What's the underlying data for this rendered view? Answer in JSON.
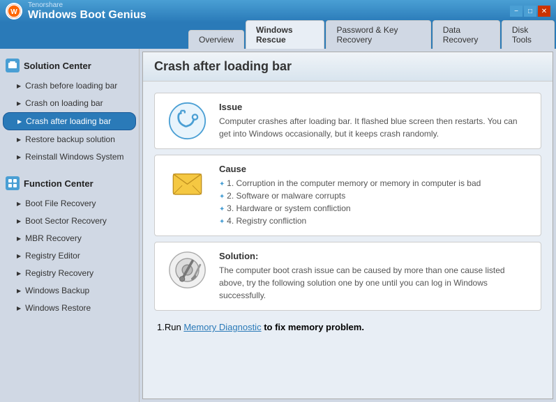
{
  "titlebar": {
    "company": "Tenorshare",
    "app_name": "Windows Boot Genius",
    "min_label": "−",
    "max_label": "□",
    "close_label": "✕"
  },
  "navbar": {
    "tabs": [
      {
        "id": "overview",
        "label": "Overview",
        "active": false
      },
      {
        "id": "windows-rescue",
        "label": "Windows Rescue",
        "active": true
      },
      {
        "id": "password-recovery",
        "label": "Password & Key Recovery",
        "active": false
      },
      {
        "id": "data-recovery",
        "label": "Data Recovery",
        "active": false
      },
      {
        "id": "disk-tools",
        "label": "Disk Tools",
        "active": false
      }
    ]
  },
  "sidebar": {
    "solution_center": {
      "header": "Solution Center",
      "items": [
        {
          "id": "crash-before",
          "label": "Crash before loading bar",
          "active": false
        },
        {
          "id": "crash-on",
          "label": "Crash on loading bar",
          "active": false
        },
        {
          "id": "crash-after",
          "label": "Crash after loading bar",
          "active": true
        },
        {
          "id": "restore-backup",
          "label": "Restore backup solution",
          "active": false
        },
        {
          "id": "reinstall-windows",
          "label": "Reinstall Windows System",
          "active": false
        }
      ]
    },
    "function_center": {
      "header": "Function Center",
      "items": [
        {
          "id": "boot-file",
          "label": "Boot File Recovery",
          "active": false
        },
        {
          "id": "boot-sector",
          "label": "Boot Sector Recovery",
          "active": false
        },
        {
          "id": "mbr-recovery",
          "label": "MBR Recovery",
          "active": false
        },
        {
          "id": "registry-editor",
          "label": "Registry Editor",
          "active": false
        },
        {
          "id": "registry-recovery",
          "label": "Registry Recovery",
          "active": false
        },
        {
          "id": "windows-backup",
          "label": "Windows Backup",
          "active": false
        },
        {
          "id": "windows-restore",
          "label": "Windows Restore",
          "active": false
        }
      ]
    }
  },
  "content": {
    "title": "Crash after loading bar",
    "issue": {
      "title": "Issue",
      "text": "Computer crashes after loading bar. It flashed blue screen then restarts. You can get into Windows occasionally, but it keeps crash randomly."
    },
    "cause": {
      "title": "Cause",
      "items": [
        "1. Corruption in the computer memory or memory in computer is bad",
        "2. Software or malware corrupts",
        "3. Hardware or system confliction",
        "4. Registry confliction"
      ]
    },
    "solution": {
      "title": "Solution:",
      "text": "The computer boot crash issue can be caused by more than one cause listed above, try the following solution one by one until you can log in Windows successfully.",
      "step1_prefix": "1.Run ",
      "step1_link": "Memory Diagnostic",
      "step1_suffix": " to fix memory problem."
    }
  }
}
